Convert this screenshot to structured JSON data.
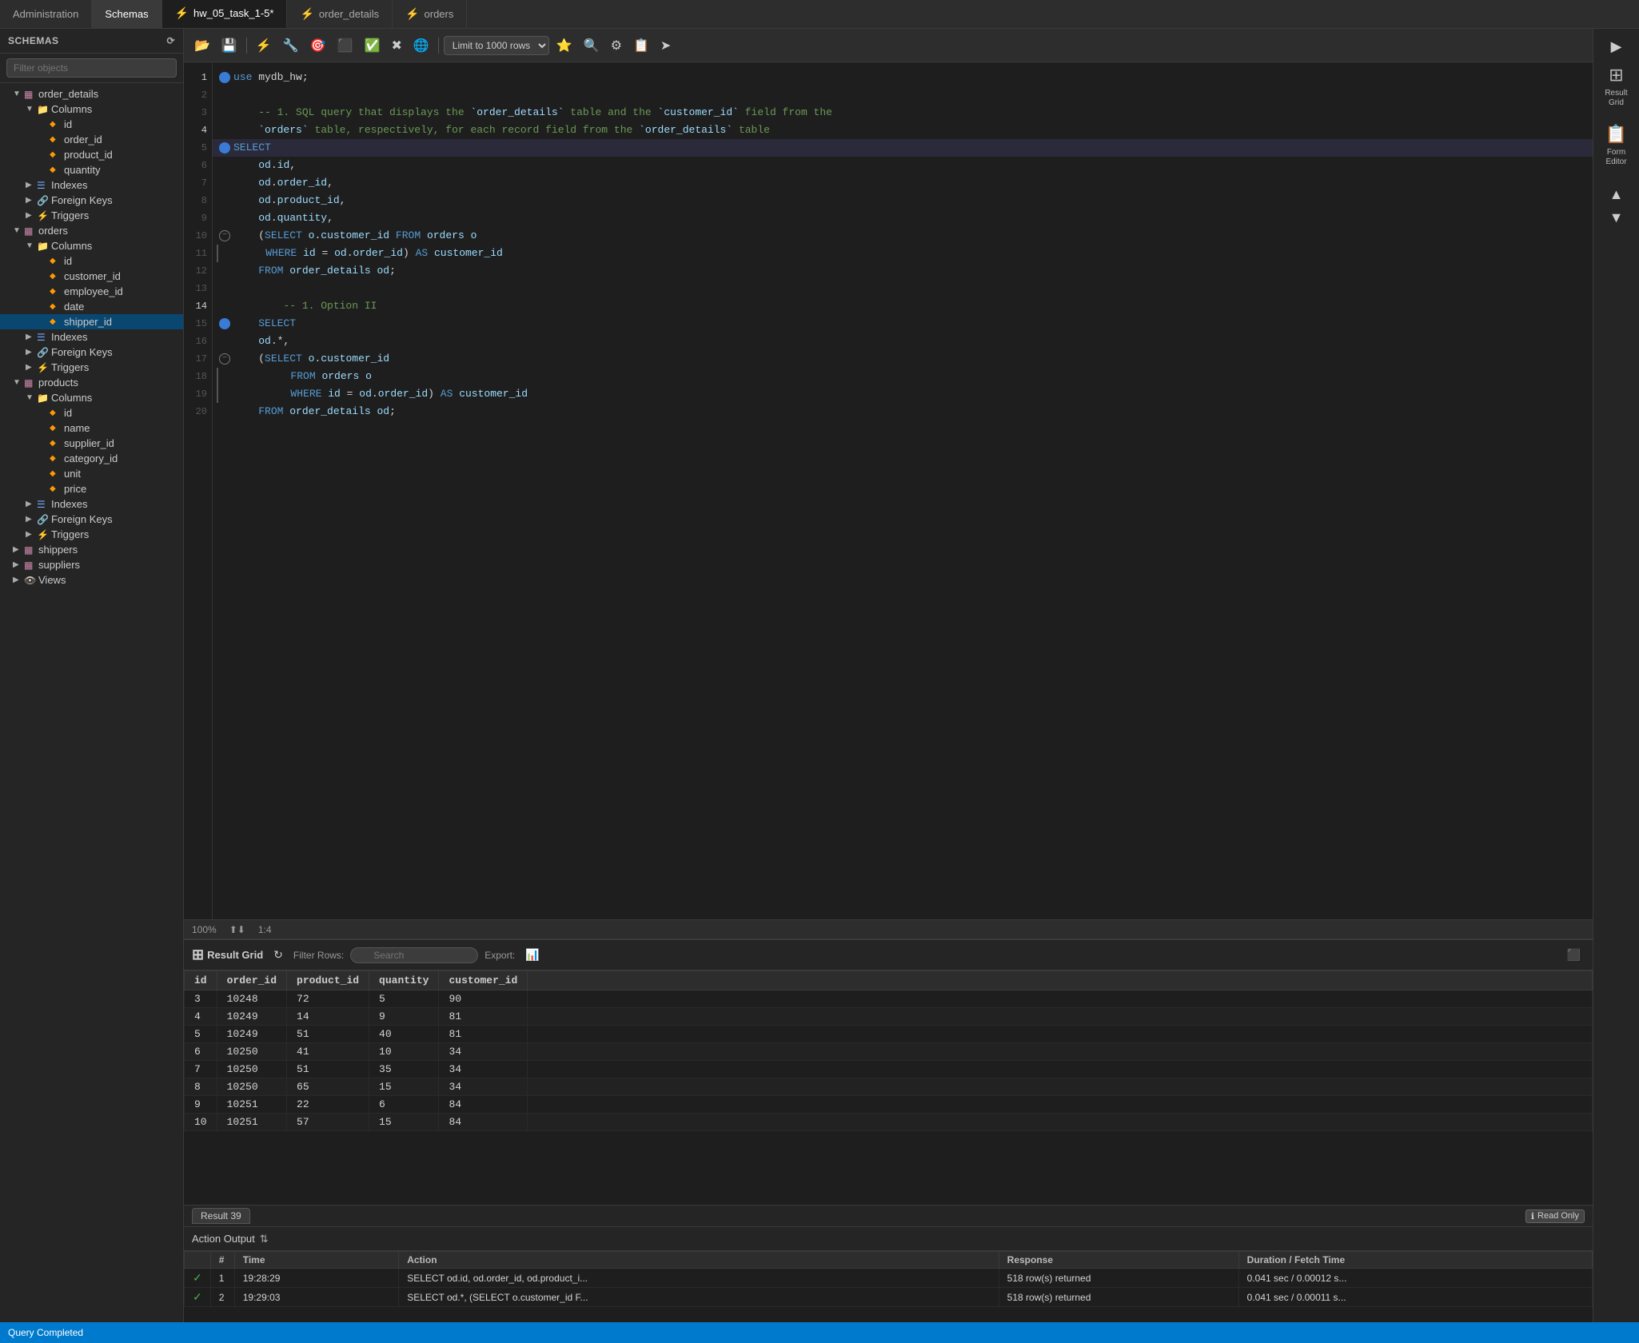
{
  "tabs": [
    {
      "label": "Administration",
      "active": false,
      "type": "admin"
    },
    {
      "label": "Schemas",
      "active": false,
      "type": "schemas"
    },
    {
      "label": "hw_05_task_1-5*",
      "active": true,
      "type": "file",
      "icon": "⚡"
    },
    {
      "label": "order_details",
      "active": false,
      "type": "file",
      "icon": "⚡"
    },
    {
      "label": "orders",
      "active": false,
      "type": "file",
      "icon": "⚡"
    }
  ],
  "sidebar": {
    "title": "SCHEMAS",
    "search_placeholder": "Filter objects",
    "items": [
      {
        "label": "order_details",
        "type": "table",
        "level": 0,
        "expanded": true
      },
      {
        "label": "Columns",
        "type": "folder",
        "level": 1,
        "expanded": true
      },
      {
        "label": "id",
        "type": "field",
        "level": 2
      },
      {
        "label": "order_id",
        "type": "field",
        "level": 2
      },
      {
        "label": "product_id",
        "type": "field",
        "level": 2
      },
      {
        "label": "quantity",
        "type": "field",
        "level": 2
      },
      {
        "label": "Indexes",
        "type": "index",
        "level": 1,
        "expanded": false
      },
      {
        "label": "Foreign Keys",
        "type": "folder",
        "level": 1,
        "expanded": false
      },
      {
        "label": "Triggers",
        "type": "folder",
        "level": 1,
        "expanded": false
      },
      {
        "label": "orders",
        "type": "table",
        "level": 0,
        "expanded": true
      },
      {
        "label": "Columns",
        "type": "folder",
        "level": 1,
        "expanded": true
      },
      {
        "label": "id",
        "type": "field",
        "level": 2
      },
      {
        "label": "customer_id",
        "type": "field",
        "level": 2
      },
      {
        "label": "employee_id",
        "type": "field",
        "level": 2
      },
      {
        "label": "date",
        "type": "field",
        "level": 2
      },
      {
        "label": "shipper_id",
        "type": "field",
        "level": 2,
        "selected": true
      },
      {
        "label": "Indexes",
        "type": "index",
        "level": 1,
        "expanded": false
      },
      {
        "label": "Foreign Keys",
        "type": "folder",
        "level": 1,
        "expanded": false
      },
      {
        "label": "Triggers",
        "type": "folder",
        "level": 1,
        "expanded": false
      },
      {
        "label": "products",
        "type": "table",
        "level": 0,
        "expanded": true
      },
      {
        "label": "Columns",
        "type": "folder",
        "level": 1,
        "expanded": true
      },
      {
        "label": "id",
        "type": "field",
        "level": 2
      },
      {
        "label": "name",
        "type": "field",
        "level": 2
      },
      {
        "label": "supplier_id",
        "type": "field",
        "level": 2
      },
      {
        "label": "category_id",
        "type": "field",
        "level": 2
      },
      {
        "label": "unit",
        "type": "field",
        "level": 2
      },
      {
        "label": "price",
        "type": "field",
        "level": 2
      },
      {
        "label": "Indexes",
        "type": "index",
        "level": 1,
        "expanded": false
      },
      {
        "label": "Foreign Keys",
        "type": "folder",
        "level": 1,
        "expanded": false
      },
      {
        "label": "Triggers",
        "type": "folder",
        "level": 1,
        "expanded": false
      },
      {
        "label": "shippers",
        "type": "table",
        "level": 0,
        "expanded": false
      },
      {
        "label": "suppliers",
        "type": "table",
        "level": 0,
        "expanded": false
      },
      {
        "label": "Views",
        "type": "views",
        "level": 0,
        "expanded": false
      }
    ]
  },
  "toolbar": {
    "limit_label": "Limit to 1000 rows",
    "buttons": [
      "📁",
      "⊞",
      "⚡",
      "🔧",
      "🎯",
      "🚫",
      "✅",
      "✖",
      "🌐",
      "★",
      "🔍",
      "⚙",
      "📋",
      "➤"
    ]
  },
  "editor": {
    "lines": [
      {
        "num": 1,
        "bp": "dot",
        "text": "use mydb_hw;",
        "tokens": [
          {
            "t": "kw",
            "v": "use"
          },
          {
            "t": "op",
            "v": " mydb_hw;"
          }
        ]
      },
      {
        "num": 2,
        "bp": "none",
        "text": ""
      },
      {
        "num": 3,
        "bp": "none",
        "text": "    -- 1. SQL query that displays the `order_details` table and the `customer_id` field from the",
        "comment": true
      },
      {
        "num": 3,
        "bp": "none",
        "text": "    `orders` table, respectively, for each record field from the `order_details` table",
        "comment": true,
        "continuation": true
      },
      {
        "num": 4,
        "bp": "dot",
        "text": "SELECT",
        "highlight": true
      },
      {
        "num": 5,
        "bp": "none",
        "text": "    od.id,"
      },
      {
        "num": 6,
        "bp": "none",
        "text": "    od.order_id,"
      },
      {
        "num": 7,
        "bp": "none",
        "text": "    od.product_id,"
      },
      {
        "num": 8,
        "bp": "none",
        "text": "    od.quantity,"
      },
      {
        "num": 9,
        "bp": "collapse",
        "text": "    (SELECT o.customer_id FROM orders o"
      },
      {
        "num": 10,
        "bp": "none",
        "text": "    WHERE id = od.order_id) AS customer_id"
      },
      {
        "num": 11,
        "bp": "none",
        "text": "    FROM order_details od;"
      },
      {
        "num": 12,
        "bp": "none",
        "text": ""
      },
      {
        "num": 13,
        "bp": "none",
        "text": "        -- 1. Option II",
        "comment": true
      },
      {
        "num": 14,
        "bp": "dot",
        "text": "    SELECT"
      },
      {
        "num": 15,
        "bp": "none",
        "text": "    od.*,"
      },
      {
        "num": 16,
        "bp": "collapse",
        "text": "    (SELECT o.customer_id"
      },
      {
        "num": 17,
        "bp": "none",
        "text": "        FROM orders o"
      },
      {
        "num": 18,
        "bp": "none",
        "text": "        WHERE id = od.order_id) AS customer_id"
      },
      {
        "num": 19,
        "bp": "none",
        "text": "    FROM order_details od;"
      },
      {
        "num": 20,
        "bp": "none",
        "text": ""
      }
    ],
    "status": {
      "zoom": "100%",
      "cursor": "1:4"
    }
  },
  "result_grid": {
    "title": "Result Grid",
    "filter_rows_label": "Filter Rows:",
    "search_placeholder": "Search",
    "export_label": "Export:",
    "columns": [
      "id",
      "order_id",
      "product_id",
      "quantity",
      "customer_id"
    ],
    "rows": [
      [
        "3",
        "10248",
        "72",
        "5",
        "90"
      ],
      [
        "4",
        "10249",
        "14",
        "9",
        "81"
      ],
      [
        "5",
        "10249",
        "51",
        "40",
        "81"
      ],
      [
        "6",
        "10250",
        "41",
        "10",
        "34"
      ],
      [
        "7",
        "10250",
        "51",
        "35",
        "34"
      ],
      [
        "8",
        "10250",
        "65",
        "15",
        "34"
      ],
      [
        "9",
        "10251",
        "22",
        "6",
        "84"
      ],
      [
        "10",
        "10251",
        "57",
        "15",
        "84"
      ]
    ],
    "result_tab": "Result 39",
    "read_only": "Read Only"
  },
  "action_output": {
    "title": "Action Output",
    "columns": [
      "",
      "Time",
      "Action",
      "Response",
      "Duration / Fetch Time"
    ],
    "rows": [
      {
        "status": "ok",
        "num": "1",
        "time": "19:28:29",
        "action": "SELECT",
        "action_detail": "od.id,    od.order_id,    od.product_i...",
        "response": "518 row(s) returned",
        "duration": "0.041 sec / 0.00012 s..."
      },
      {
        "status": "ok",
        "num": "2",
        "time": "19:29:03",
        "action": "SELECT",
        "action_detail": "od.*,    (SELECT o.customer_id    F...",
        "response": "518 row(s) returned",
        "duration": "0.041 sec / 0.00011 s..."
      }
    ]
  },
  "right_panel": {
    "result_grid_label": "Result\nGrid",
    "form_editor_label": "Form\nEditor"
  },
  "status_bar": {
    "message": "Query Completed"
  }
}
